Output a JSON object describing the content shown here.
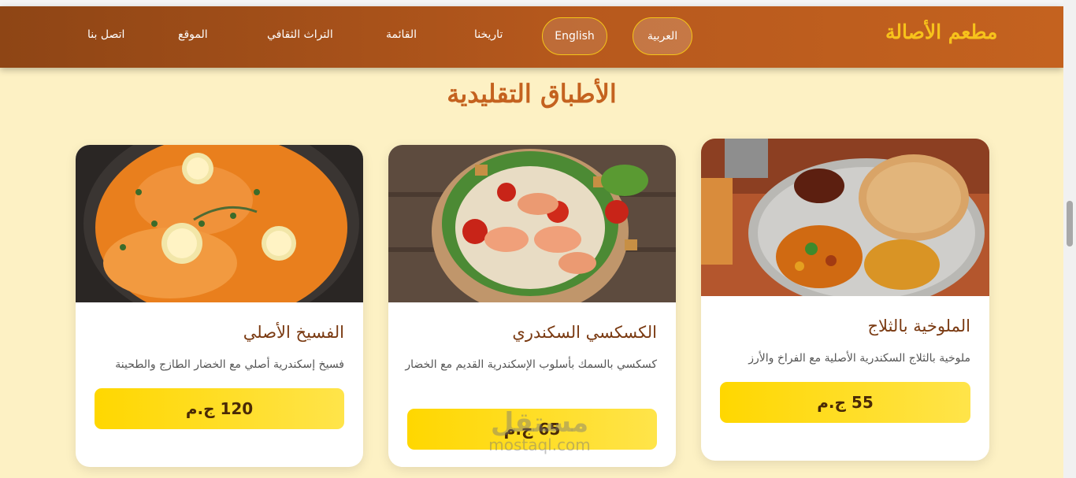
{
  "header": {
    "brand": "مطعم الأصالة",
    "lang_ar": "العربية",
    "lang_en": "English",
    "nav": [
      "تاريخنا",
      "القائمة",
      "التراث الثقافي",
      "الموقع",
      "اتصل بنا"
    ]
  },
  "section": {
    "title": "الأطباق التقليدية"
  },
  "cards": [
    {
      "title": "الملوخية بالثلاج",
      "desc": "ملوخية بالثلاج السكندرية الأصلية مع الفراخ والأرز",
      "price": "55 ج.م",
      "image_icon": "molokhia-platter-image"
    },
    {
      "title": "الكسكسي السكندري",
      "desc": "كسكسي بالسمك بأسلوب الإسكندرية القديم مع الخضار",
      "price": "65 ج.م",
      "image_icon": "shrimp-salad-image"
    },
    {
      "title": "الفسيخ الأصلي",
      "desc": "فسيخ إسكندرية أصلي مع الخضار الطازج والطحينة",
      "price": "120 ج.م",
      "image_icon": "fish-curry-image"
    }
  ],
  "watermark": {
    "ar": "مستقل",
    "en": "mostaql.com"
  },
  "colors": {
    "accent": "#c4621f",
    "gold": "#ffd700",
    "background": "#fdf1c4"
  }
}
